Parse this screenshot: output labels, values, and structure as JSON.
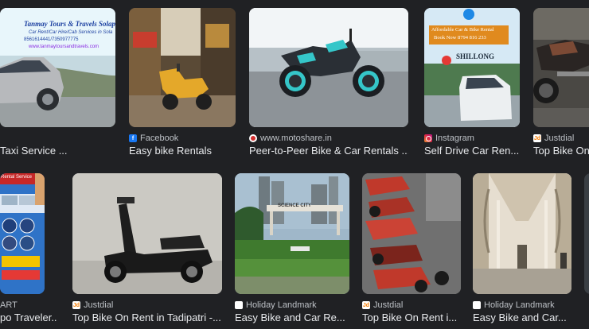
{
  "results": [
    {
      "source": "",
      "title": "Taxi Service ...",
      "thumb_text": {
        "line1": "Tanmay Tours & Travels Solap",
        "line2": "Car Rent/Car Hire/Cab Services in Sola",
        "line3": "8561614441/7350977775",
        "line4": "www.tanmaytoursandtravels.com"
      }
    },
    {
      "source": "Facebook",
      "title": "Easy bike Rentals"
    },
    {
      "source": "www.motoshare.in",
      "title": "Peer-to-Peer Bike & Car Rentals ..."
    },
    {
      "source": "Instagram",
      "title": "Self Drive Car Ren...",
      "thumb_text": {
        "line1": "Affordable Car & Bike Rental",
        "line2": "Book Now 8794 816 233",
        "line3": "SHILLONG"
      }
    },
    {
      "source": "Justdial",
      "title": "Top Bike On"
    },
    {
      "source": "ART",
      "title": "po Traveler...",
      "thumb_text": {
        "line1": "Rental Service"
      }
    },
    {
      "source": "Justdial",
      "title": "Top Bike On Rent in Tadipatri -..."
    },
    {
      "source": "Holiday Landmark",
      "title": "Easy Bike and Car Re...",
      "thumb_text": {
        "line1": "SCIENCE CITY"
      }
    },
    {
      "source": "Justdial",
      "title": "Top Bike On Rent i..."
    },
    {
      "source": "Holiday Landmark",
      "title": "Easy Bike and Car..."
    },
    {
      "source": "",
      "title": ""
    }
  ],
  "colors": {
    "background": "#202124",
    "title_text": "#e8eaed",
    "source_text": "#bdc1c6",
    "facebook": "#1877f2",
    "justdial": "#f57c00",
    "instagram": "#d6249f"
  }
}
